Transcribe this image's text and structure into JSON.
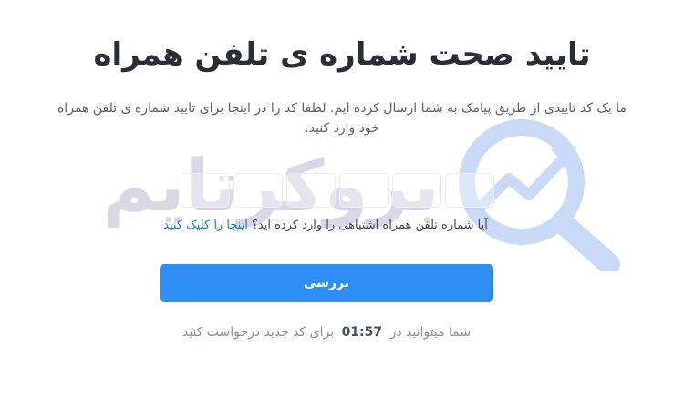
{
  "page": {
    "title": "تایید صحت شماره ی تلفن همراه",
    "description": "ما یک کد تاییدی از طریق پیامک به شما ارسال کرده ایم. لطفا کد را در اینجا برای تایید شماره ی تلفن همراه خود وارد کنید."
  },
  "watermark": {
    "text": "بروکرتایم",
    "logo_icon": "chart-magnifier-icon"
  },
  "code_inputs": [
    "",
    "",
    "",
    "",
    "",
    ""
  ],
  "wrong_number": {
    "question": "آیا شماره تلفن همراه اشتباهی را وارد کرده اید؟",
    "link_label": "اینجا را کلیک کنید"
  },
  "submit": {
    "label": "بررسی"
  },
  "resend": {
    "prefix": "شما میتوانید در",
    "timer": "01:57",
    "suffix": "برای کد جدید درخواست کنید"
  },
  "colors": {
    "primary": "#2f8ef4",
    "link": "#1f78d1",
    "watermark_text": "#d9d8e4",
    "watermark_logo": "#c9daf6"
  }
}
